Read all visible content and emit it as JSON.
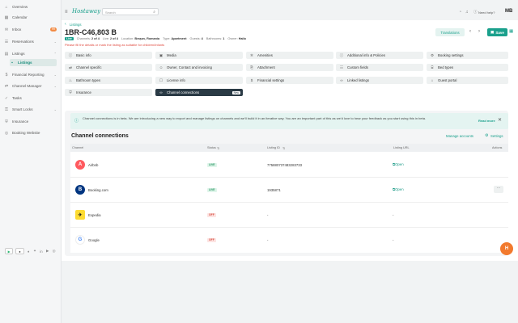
{
  "sidebar": {
    "items": [
      {
        "label": "Overview",
        "icon": "home-icon"
      },
      {
        "label": "Calendar",
        "icon": "calendar-icon"
      },
      {
        "label": "Inbox",
        "icon": "inbox-icon",
        "badge": "99"
      },
      {
        "label": "Reservations",
        "icon": "reservations-icon"
      },
      {
        "label": "Listings",
        "icon": "listings-icon"
      },
      {
        "label": "Listings",
        "icon": "",
        "sub": true
      },
      {
        "label": "Financial Reporting",
        "icon": "finance-icon"
      },
      {
        "label": "Channel Manager",
        "icon": "channel-icon"
      },
      {
        "label": "Tasks",
        "icon": "tasks-icon"
      },
      {
        "label": "Smart Locks",
        "icon": "lock-icon"
      },
      {
        "label": "Insurance",
        "icon": "insurance-icon"
      },
      {
        "label": "Booking Website",
        "icon": "globe-icon"
      }
    ],
    "store_labels": [
      "▶",
      "●"
    ],
    "social": [
      "♦",
      "✦",
      "in",
      "▶",
      "◎"
    ]
  },
  "topbar": {
    "brand": "Hostaway",
    "search_placeholder": "Search",
    "help": "Need help?",
    "user_initials": "MB"
  },
  "header": {
    "breadcrumb": "Listings",
    "title": "1BR-C46,803 B",
    "status_badge": "Live",
    "meta": [
      {
        "k": "Channels:",
        "v": "2 of 4"
      },
      {
        "k": "Live:",
        "v": "2 of 4"
      },
      {
        "k": "Location:",
        "v": "Brașov, Romania"
      },
      {
        "k": "Type:",
        "v": "Apartment"
      },
      {
        "k": "Guests:",
        "v": "4"
      },
      {
        "k": "Bathrooms:",
        "v": "1"
      },
      {
        "k": "Owner:",
        "v": "Hailo"
      }
    ],
    "warning": "Please fill the details or mark the listing as suitable for children/infants",
    "translations_label": "Translations",
    "save_label": "Save"
  },
  "sections": [
    [
      "Basic info",
      "Media",
      "Amenities",
      "Additional info & Policies",
      "Booking settings"
    ],
    [
      "Channel specific",
      "Owner, Contact and invoicing",
      "Attachment",
      "Custom fields",
      "Bed types"
    ],
    [
      "Bathroom types",
      "License info",
      "Financial settings",
      "Linked listings",
      "Guest portal"
    ],
    [
      "Insurance",
      "Channel connections"
    ]
  ],
  "new_tag": "New",
  "banner": {
    "text": "Channel connections is in beta. We are introducing a new way to export and manage listings on channels and we'll build it in an iterative way. You are an important part of this as we'd love to hear your feedback as you start using this in beta.",
    "read_more": "Read more"
  },
  "connections": {
    "title": "Channel connections",
    "manage_label": "Manage accounts",
    "settings_label": "Settings",
    "columns": [
      "Channel",
      "Status",
      "Listing ID",
      "Listing URL",
      "Actions"
    ],
    "rows": [
      {
        "channel": "Airbnb",
        "status": "LIVE",
        "listing_id": "775880737483283733",
        "url": "Open",
        "color": "#ff5a5f",
        "glyph": "A"
      },
      {
        "channel": "Booking.com",
        "status": "LIVE",
        "listing_id": "1935871",
        "url": "Open",
        "color": "#003580",
        "glyph": "B"
      },
      {
        "channel": "Expedia",
        "status": "OFF",
        "listing_id": "-",
        "url": "-",
        "color": "#fddb32",
        "glyph": "✈"
      },
      {
        "channel": "Google",
        "status": "OFF",
        "listing_id": "-",
        "url": "-",
        "color": "#ffffff",
        "glyph": "G"
      }
    ]
  },
  "fab_label": "H",
  "colors": {
    "accent": "#1aa08c",
    "primary_dark": "#2a3a45",
    "warning": "#e04a3f",
    "orange": "#f28b45"
  }
}
